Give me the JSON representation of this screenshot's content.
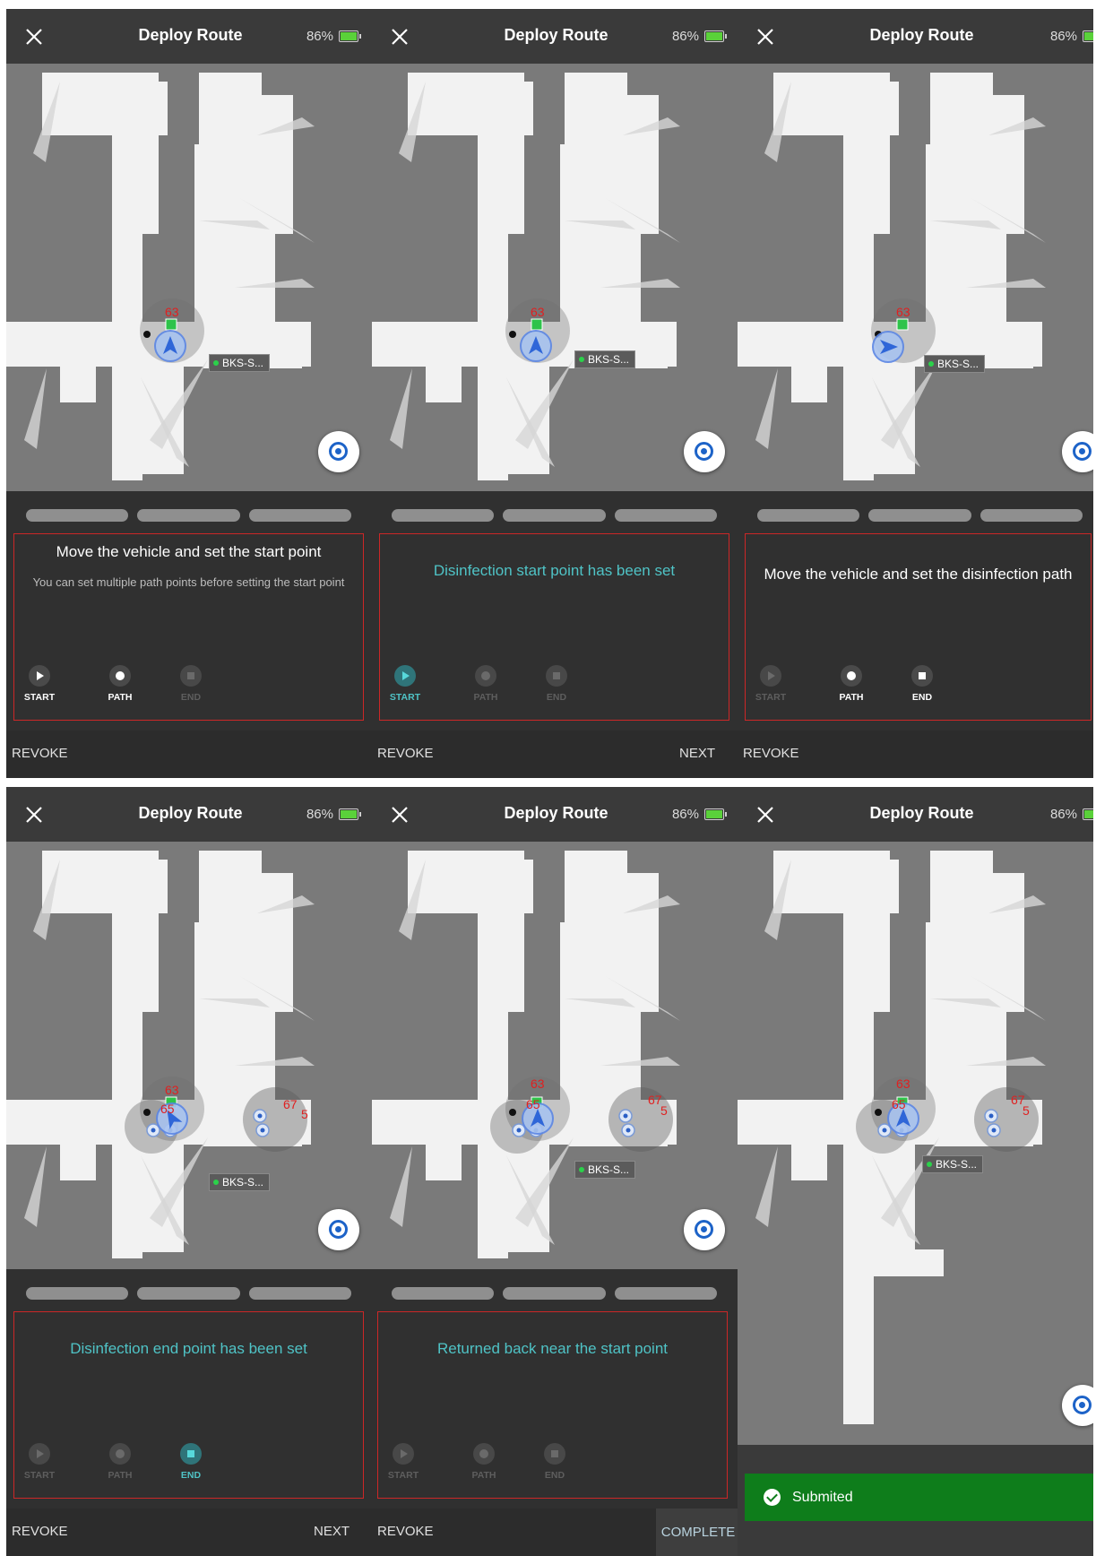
{
  "header": {
    "title": "Deploy Route",
    "battery": "86%"
  },
  "robot_label": "BKS-S...",
  "map_numbers": [
    "63",
    "65",
    "67",
    "5"
  ],
  "modes": {
    "start": "START",
    "path": "PATH",
    "end": "END"
  },
  "panels": [
    {
      "message_title": "Move the vehicle and set the start point",
      "message_sub": "You can set multiple path points before setting the start point",
      "left_button": "REVOKE",
      "right_button": ""
    },
    {
      "message_title": "Disinfection start point has been set",
      "left_button": "REVOKE",
      "right_button": "NEXT"
    },
    {
      "message_title": "Move the vehicle and set the disinfection path",
      "left_button": "REVOKE",
      "right_button": ""
    },
    {
      "message_title": "Disinfection end point has been set",
      "left_button": "REVOKE",
      "right_button": "NEXT"
    },
    {
      "message_title": "Returned back near the start point",
      "left_button": "REVOKE",
      "right_button": "COMPLETE"
    },
    {
      "toast": "Submited"
    }
  ],
  "colors": {
    "accent": "#4fc3c6",
    "error_border": "#cc2727",
    "toast": "#0e7d1b",
    "battery": "#5ad13a"
  },
  "icons": [
    "close-icon",
    "battery-icon",
    "locate-icon",
    "play-icon",
    "dot-icon",
    "stop-icon",
    "check-icon"
  ]
}
